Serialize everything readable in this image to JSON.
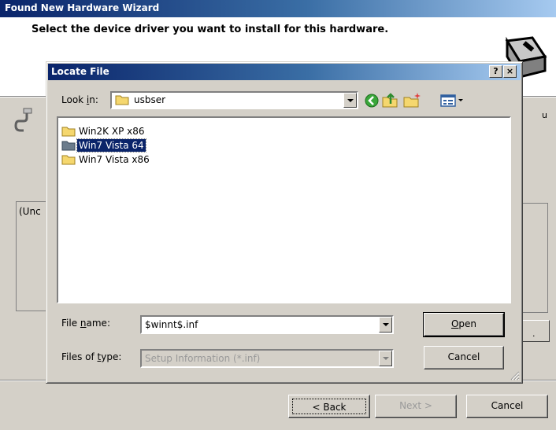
{
  "wizard": {
    "title": "Found New Hardware Wizard",
    "heading": "Select the device driver you want to install for this hardware.",
    "model_text": "(Unc",
    "right_letter": "u",
    "right_button_dots": ".",
    "left_line": "-",
    "buttons": {
      "back": "< Back",
      "next": "Next >",
      "cancel": "Cancel"
    }
  },
  "dialog": {
    "title": "Locate File",
    "help_button": "?",
    "close_button": "×",
    "look_in": {
      "label_pre": "Look ",
      "label_accel": "i",
      "label_post": "n:",
      "value": "usbser"
    },
    "files": [
      {
        "name": "Win2K XP x86",
        "selected": false
      },
      {
        "name": "Win7 Vista 64",
        "selected": true
      },
      {
        "name": "Win7 Vista x86",
        "selected": false
      }
    ],
    "file_name": {
      "label_pre": "File ",
      "label_accel": "n",
      "label_post": "ame:",
      "value": "$winnt$.inf"
    },
    "file_type": {
      "label_pre": "Files of ",
      "label_accel": "t",
      "label_post": "ype:",
      "value": "Setup Information (*.inf)"
    },
    "open_button": {
      "accel": "O",
      "rest": "pen"
    },
    "cancel_button": "Cancel"
  },
  "colors": {
    "titlebar_start": "#0a246a",
    "titlebar_end": "#a6caf0",
    "face": "#d4d0c8",
    "selection": "#0a246a",
    "folder": "#f5d76e"
  }
}
